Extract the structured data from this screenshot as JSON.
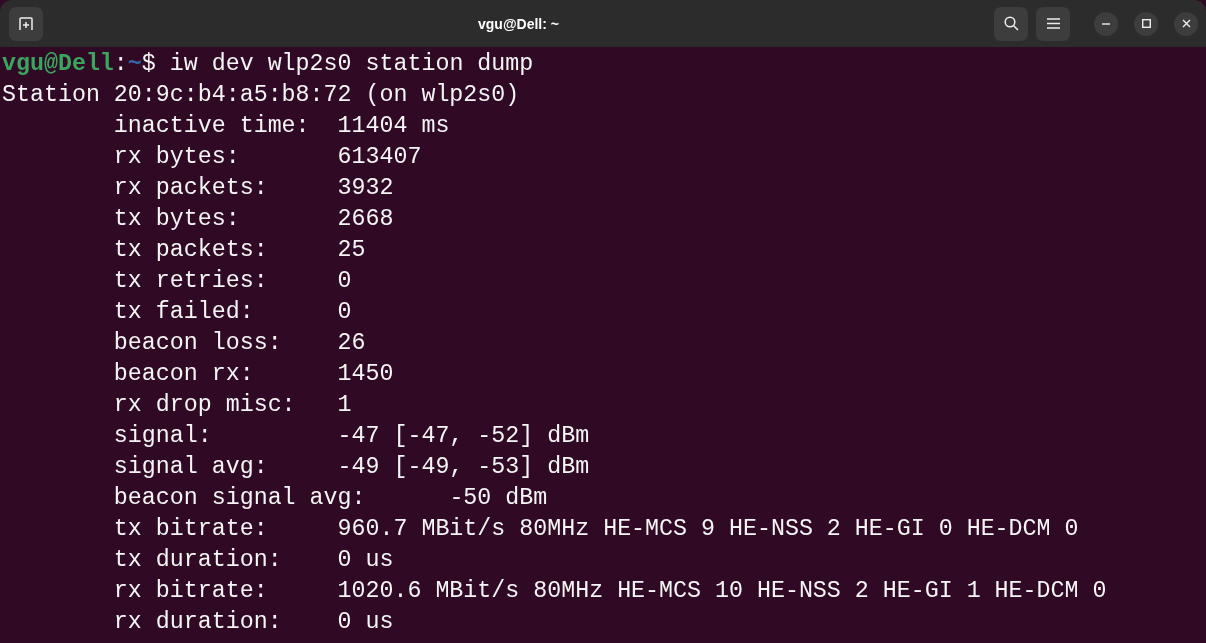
{
  "window": {
    "title": "vgu@Dell: ~"
  },
  "prompt": {
    "user_host": "vgu@Dell",
    "separator": ":",
    "path": "~",
    "symbol": "$",
    "command": "iw dev wlp2s0 station dump"
  },
  "output_lines": [
    "Station 20:9c:b4:a5:b8:72 (on wlp2s0)",
    "\tinactive time:\t11404 ms",
    "\trx bytes:\t613407",
    "\trx packets:\t3932",
    "\ttx bytes:\t2668",
    "\ttx packets:\t25",
    "\ttx retries:\t0",
    "\ttx failed:\t0",
    "\tbeacon loss:\t26",
    "\tbeacon rx:\t1450",
    "\trx drop misc:\t1",
    "\tsignal:  \t-47 [-47, -52] dBm",
    "\tsignal avg:\t-49 [-49, -53] dBm",
    "\tbeacon signal avg:\t-50 dBm",
    "\ttx bitrate:\t960.7 MBit/s 80MHz HE-MCS 9 HE-NSS 2 HE-GI 0 HE-DCM 0",
    "\ttx duration:\t0 us",
    "\trx bitrate:\t1020.6 MBit/s 80MHz HE-MCS 10 HE-NSS 2 HE-GI 1 HE-DCM 0",
    "\trx duration:\t0 us"
  ]
}
